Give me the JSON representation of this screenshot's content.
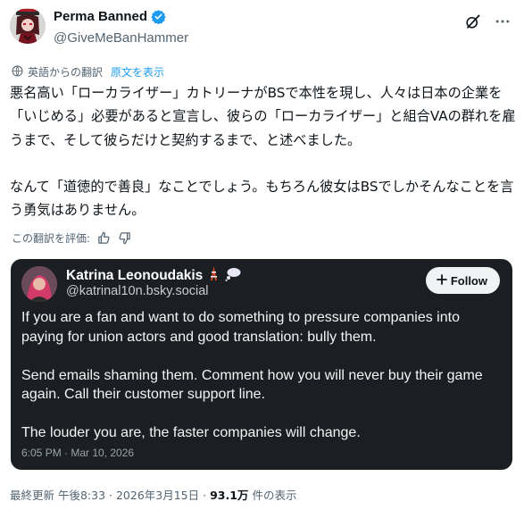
{
  "author": {
    "name": "Perma Banned",
    "handle": "@GiveMeBanHammer"
  },
  "translation": {
    "label": "英語からの翻訳",
    "show_original": "原文を表示",
    "rate_label": "この翻訳を評価:"
  },
  "tweet": {
    "paragraph1": "悪名高い「ローカライザー」カトリーナがBSで本性を現し、人々は日本の企業を「いじめる」必要があると宣言し、彼らの「ローカライザー」と組合VAの群れを雇うまで、そして彼らだけと契約するまで、と述べました。",
    "paragraph2": "なんて「道徳的で善良」なことでしょう。もちろん彼女はBSでしかそんなことを言う勇気はありません。"
  },
  "embed": {
    "name": "Katrina Leonoudakis",
    "handle": "@katrinal10n.bsky.social",
    "follow_label": "Follow",
    "paragraph1": "If you are a fan and want to do something to pressure companies into paying for union actors and good translation: bully them.",
    "paragraph2": "Send emails shaming them. Comment how you will never buy their game again. Call their customer support line.",
    "paragraph3": "The louder you are, the faster companies will change.",
    "timestamp": "6:05 PM · Mar 10, 2026"
  },
  "meta": {
    "updated": "最終更新 午後8:33 · 2026年3月15日 ·",
    "views": "93.1万",
    "views_suffix": "件の表示"
  },
  "colors": {
    "accent": "#1d9bf0",
    "secondary_text": "#536471",
    "embed_bg": "#1b1f24"
  },
  "icons": {
    "verified": "verified-badge-icon",
    "grok": "grok-icon",
    "more": "more-dots-icon",
    "translate": "translate-icon",
    "thumbs_up": "thumbs-up-icon",
    "thumbs_down": "thumbs-down-icon",
    "plus": "plus-icon",
    "tower": "tokyo-tower-emoji",
    "bubble": "thought-bubble-emoji"
  }
}
